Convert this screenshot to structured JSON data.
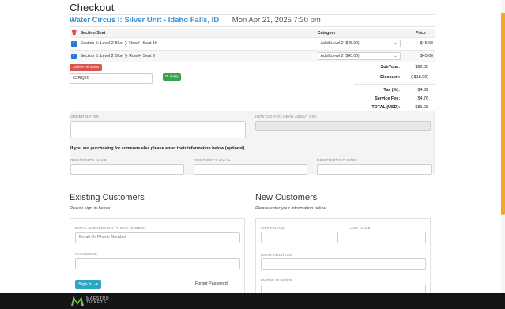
{
  "page": {
    "title": "Checkout"
  },
  "event": {
    "name": "Water Circus I: Silver Unit - Idaho Falls, ID",
    "date": "Mon Apr 21, 2025 7:30 pm"
  },
  "cart": {
    "headers": {
      "section": "Section/Seat",
      "category": "Category",
      "price": "Price"
    },
    "items": [
      {
        "seat": "Section 5: Level 2 Blue ❯ Row H Seat 10",
        "category": "Adult Level 2 ($45.00)",
        "price": "$45.00"
      },
      {
        "seat": "Section 5: Level 2 Blue ❯ Row H Seat 9",
        "category": "Adult Level 2 ($45.00)",
        "price": "$45.00"
      }
    ],
    "delete_all_label": "Delete All Items",
    "coupon_value": "CIRQ20",
    "apply_label": "apply"
  },
  "summary": {
    "subtotal_label": "SubTotal:",
    "subtotal": "$90.00",
    "discount_label": "Discount:",
    "discount": "(-$18.00)",
    "tax_label": "Tax (%):",
    "tax": "$4.32",
    "fee_label": "Service Fee:",
    "fee": "$4.76",
    "total_label": "TOTAL (USD):",
    "total": "$81.08"
  },
  "notes": {
    "order_notes_label": "ORDER NOTES",
    "hear_label": "HOW DID YOU HEAR ABOUT US?",
    "purchasing_text": "If you are purchasing for someone else please enter their information below (optional)",
    "recipient_name_label": "RECIPIENT'S NAME",
    "recipient_email_label": "RECIPIENT'S EMAIL",
    "recipient_phone_label": "RECIPIENT'S PHONE"
  },
  "existing": {
    "heading": "Existing Customers",
    "sub": "Please sign in below",
    "email_label": "EMAIL ADDRESS OR PHONE NUMBER",
    "email_placeholder": "Email Or Phone Number",
    "password_label": "PASSWORD",
    "signin_label": "Sign In",
    "forgot_label": "Forgot Password"
  },
  "new_customers": {
    "heading": "New Customers",
    "sub": "Please enter your information below.",
    "first_label": "FIRST NAME",
    "last_label": "LAST NAME",
    "email_label": "EMAIL ADDRESS",
    "phone_label": "PHONE NUMBER"
  },
  "footer": {
    "brand_line1": "MAESTRO",
    "brand_line2": "TICKETS"
  },
  "colors": {
    "accent": "#f5a623",
    "event_link": "#3b8fd3",
    "danger": "#d9534f",
    "success": "#3aa04a",
    "info": "#2aa7c0"
  }
}
